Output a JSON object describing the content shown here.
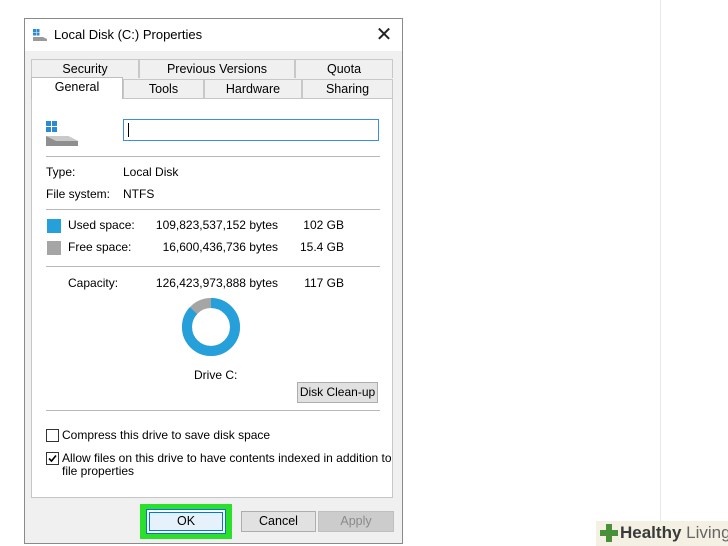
{
  "window": {
    "title": "Local Disk (C:) Properties",
    "close_symbol": "✕"
  },
  "tabs": {
    "row1": [
      "Security",
      "Previous Versions",
      "Quota"
    ],
    "row2": [
      "General",
      "Tools",
      "Hardware",
      "Sharing"
    ],
    "active": "General"
  },
  "general": {
    "name_value": "",
    "type_label": "Type:",
    "type_value": "Local Disk",
    "fs_label": "File system:",
    "fs_value": "NTFS",
    "used_label": "Used space:",
    "used_bytes": "109,823,537,152 bytes",
    "used_gb": "102 GB",
    "free_label": "Free space:",
    "free_bytes": "16,600,436,736 bytes",
    "free_gb": "15.4 GB",
    "capacity_label": "Capacity:",
    "capacity_bytes": "126,423,973,888 bytes",
    "capacity_gb": "117 GB",
    "drive_label": "Drive C:",
    "cleanup_label": "Disk Clean-up",
    "compress_label": "Compress this drive to save disk space",
    "compress_checked": false,
    "index_label_line1": "Allow files on this drive to have contents indexed in addition to",
    "index_label_line2": "file properties",
    "index_checked": true,
    "used_fraction": 0.8687
  },
  "buttons": {
    "ok": "OK",
    "cancel": "Cancel",
    "apply": "Apply"
  },
  "colors": {
    "used": "#26a0da",
    "free": "#a5a5a5",
    "highlight": "#2be02b",
    "accent": "#0078d7"
  },
  "icons": {
    "title": "drive-icon",
    "close": "close-icon",
    "check": "check-icon",
    "brand": "plus-cross-icon"
  },
  "watermark": {
    "strong": "Healthy",
    "light": "Living"
  }
}
